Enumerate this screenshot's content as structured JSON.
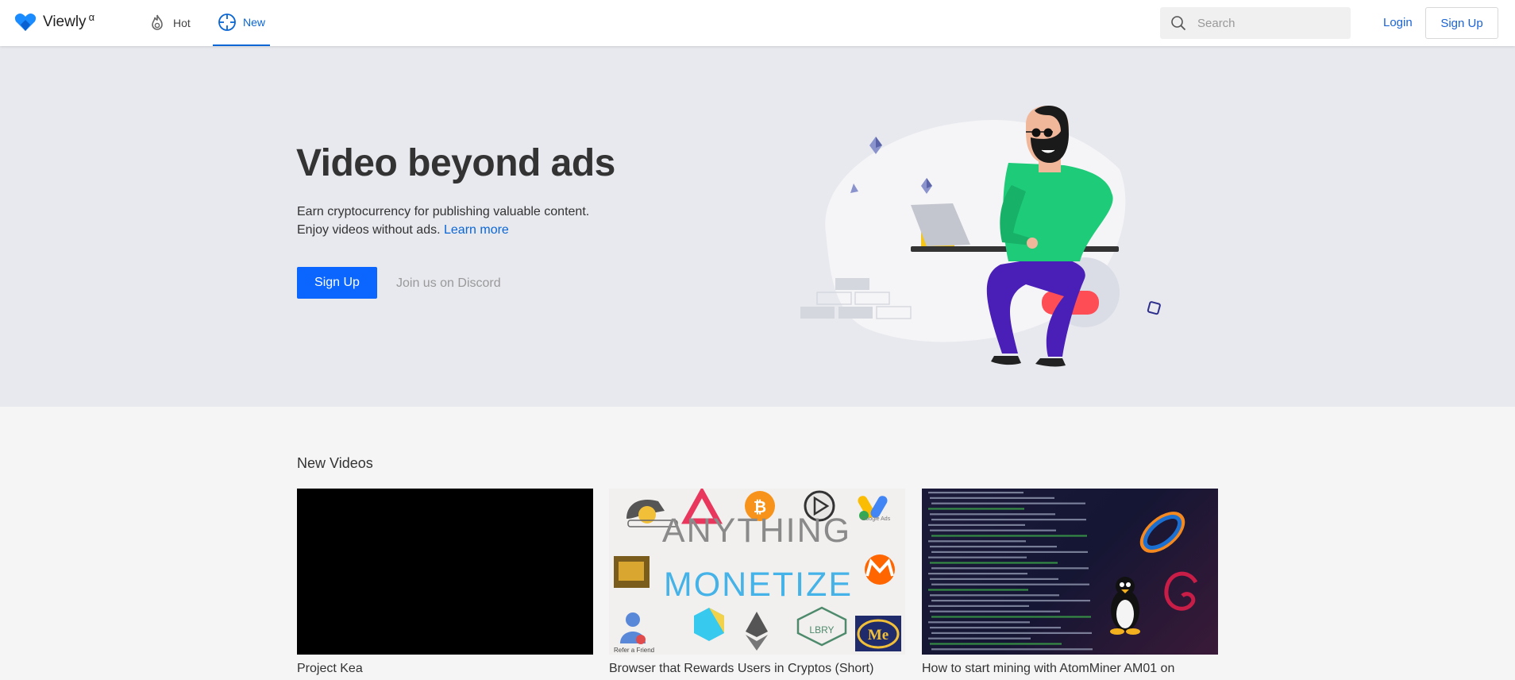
{
  "header": {
    "logo_text": "Viewly",
    "logo_alpha": "α",
    "tabs": [
      {
        "label": "Hot",
        "icon": "flame-icon"
      },
      {
        "label": "New",
        "icon": "crosshair-icon",
        "active": true
      }
    ],
    "search_placeholder": "Search",
    "login_label": "Login",
    "signup_label": "Sign Up"
  },
  "hero": {
    "title": "Video beyond ads",
    "line1": "Earn cryptocurrency for publishing valuable content.",
    "line2": "Enjoy videos without ads.",
    "learn_more": "Learn more",
    "signup_label": "Sign Up",
    "discord_label": "Join us on Discord"
  },
  "videos_section": {
    "title": "New Videos",
    "videos": [
      {
        "title": "Project Kea"
      },
      {
        "title": "Browser that Rewards Users in Cryptos (Short)",
        "thumb": {
          "line1": "ANYTHING",
          "line2": "MONETIZE",
          "google_ads": "Google Ads",
          "lbry": "LBRY",
          "me": "Me",
          "refer": "Refer a Friend"
        }
      },
      {
        "title": "How to start mining with AtomMiner AM01 on"
      }
    ]
  },
  "colors": {
    "accent": "#0a66ff",
    "link": "#1a63d4",
    "hero_bg": "#e8e9ee",
    "page_bg": "#f4f5f4",
    "shirt": "#1ecb78",
    "pants": "#4a1fb8",
    "seat": "#ff4d55"
  }
}
